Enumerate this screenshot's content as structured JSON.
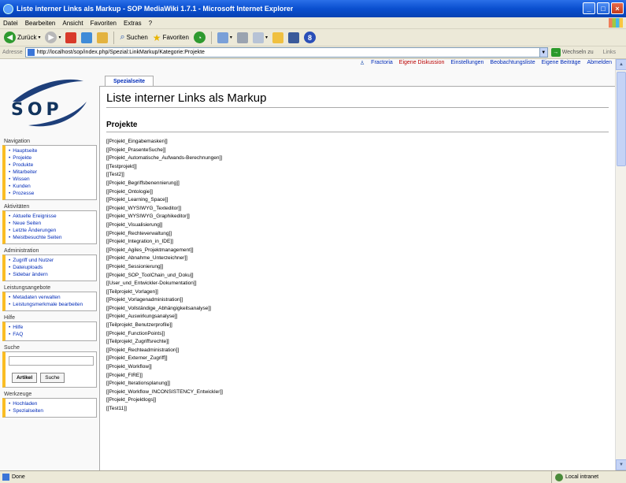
{
  "window": {
    "title": "Liste interner Links als Markup - SOP MediaWiki 1.7.1 - Microsoft Internet Explorer",
    "controls": [
      "_",
      "□",
      "×"
    ]
  },
  "menubar": [
    "Datei",
    "Bearbeiten",
    "Ansicht",
    "Favoriten",
    "Extras",
    "?"
  ],
  "toolbar": {
    "back_label": "Zurück",
    "search_label": "Suchen",
    "favorites_label": "Favoriten"
  },
  "address": {
    "label": "Adresse",
    "url": "http://localhost/sop/index.php/Spezial:LinkMarkup/Kategorie:Projekte",
    "go_label": "Wechseln zu",
    "links_label": "Links"
  },
  "personal_links": [
    {
      "label": "Fractoria",
      "new": false
    },
    {
      "label": "Eigene Diskussion",
      "new": true
    },
    {
      "label": "Einstellungen",
      "new": false
    },
    {
      "label": "Beobachtungsliste",
      "new": false
    },
    {
      "label": "Eigene Beiträge",
      "new": false
    },
    {
      "label": "Abmelden",
      "new": false
    }
  ],
  "logo_text": "SOP",
  "tab_label": "Spezialseite",
  "page_title": "Liste interner Links als Markup",
  "section_title": "Projekte",
  "links": [
    "[[Projekt_Eingabemasken]]",
    "[[Projekt_PrasenteSuche]]",
    "[[Projekt_Automatische_Aufwands-Berechnungen]]",
    "[[Testprojekt]]",
    "[[Test2]]",
    "[[Projekt_Begriffsbenennierung]]",
    "[[Projekt_Ontologie]]",
    "[[Projekt_Learning_Space]]",
    "[[Projekt_WYSIWYG_Texteditor]]",
    "[[Projekt_WYSIWYG_Graphikeditor]]",
    "[[Projekt_Visualisierung]]",
    "[[Projekt_Rechteverwaltung]]",
    "[[Projekt_Integration_in_IDE]]",
    "[[Projekt_Agiles_Projektmanagement]]",
    "[[Projekt_Abnahme_Unterzeichner]]",
    "[[Projekt_Sessionierung]]",
    "[[Projekt_SOP_ToolChain_und_Doku]]",
    "[[User_und_Entwickler-Dokumentation]]",
    "[[Teilprojekt_Vorlagen]]",
    "[[Projekt_Vorlagenadministration]]",
    "[[Projekt_Vollständige_Abhängigkeitsanalyse]]",
    "[[Projekt_Auswirkungsanalyse]]",
    "[[Teilprojekt_Benutzerprofile]]",
    "[[Projekt_FunctionPoints]]",
    "[[Teilprojekt_Zugriffsrechte]]",
    "[[Projekt_Rechteadministration]]",
    "[[Projekt_Externer_Zugriff]]",
    "[[Projekt_Workflow]]",
    "[[Projekt_FIRE]]",
    "[[Projekt_Iterationsplanung]]",
    "[[Projekt_Workflow_INCONSISTENCY_Entwickler]]",
    "[[Projekt_Projektlogs]]",
    "[[Test11]]"
  ],
  "sidebar": {
    "navigation": {
      "title": "Navigation",
      "items": [
        "Hauptseite",
        "Projekte",
        "Produkte",
        "Mitarbeiter",
        "Wissen",
        "Kunden",
        "Prozesse"
      ]
    },
    "aktivitaeten": {
      "title": "Aktivitäten",
      "items": [
        "Aktuelle Ereignisse",
        "Neue Seiten",
        "Letzte Änderungen",
        "Meistbesuchte Seiten"
      ]
    },
    "administration": {
      "title": "Administration",
      "items": [
        "Zugriff und Nutzer",
        "Dateiuploads",
        "Sidebar ändern"
      ]
    },
    "leistungen": {
      "title": "Leistungsangebote",
      "items": [
        "Metadaten verwalten",
        "Leistungsmerkmale bearbeiten"
      ]
    },
    "hilfe": {
      "title": "Hilfe",
      "items": [
        "Hilfe",
        "FAQ"
      ]
    },
    "suche": {
      "title": "Suche",
      "go_label": "Artikel",
      "search_label": "Suche"
    },
    "werkzeuge": {
      "title": "Werkzeuge",
      "items": [
        "Hochladen",
        "Spezialseiten"
      ]
    }
  },
  "status": {
    "left": "Done",
    "right": "Local intranet"
  }
}
